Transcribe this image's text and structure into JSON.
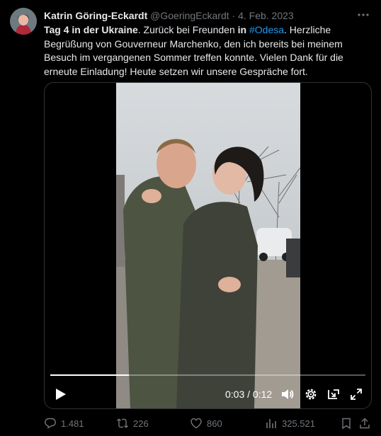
{
  "author": {
    "name": "Katrin Göring-Eckardt",
    "handle": "@GoeringEckardt",
    "separator": "·",
    "date": "4. Feb. 2023"
  },
  "tweet": {
    "part1_bold": "Tag 4 in der Ukraine",
    "part2": ". Zurück bei Freunden ",
    "part3_bold": "in",
    "part4": " ",
    "hashtag": "#Odesa",
    "part5": ". Herzliche Begrüßung von Gouverneur Marchenko, den ich bereits bei meinem Besuch im vergangenen Sommer treffen konnte. Vielen Dank für die erneute Einladung! Heute setzen wir unsere Gespräche fort."
  },
  "video": {
    "time_current": "0:03",
    "time_separator": " / ",
    "time_total": "0:12",
    "progress_fraction": 0.25
  },
  "actions": {
    "replies": "1.481",
    "reposts": "226",
    "likes": "860",
    "views": "325.521"
  },
  "colors": {
    "background": "#000000",
    "text": "#e7e9ea",
    "muted": "#71767b",
    "link": "#1d9bf0"
  }
}
